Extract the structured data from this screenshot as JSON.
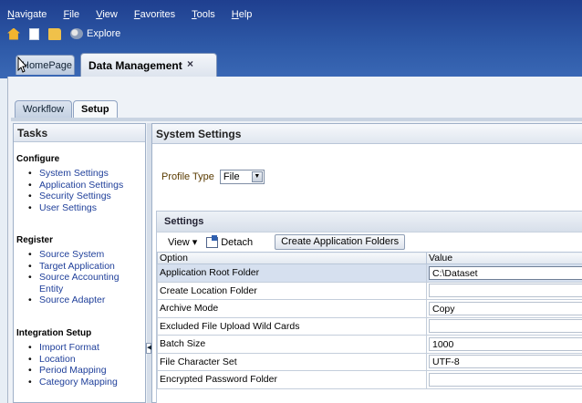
{
  "menu": [
    "Navigate",
    "File",
    "View",
    "Favorites",
    "Tools",
    "Help"
  ],
  "toolbar": {
    "explore_label": "Explore"
  },
  "outer_tabs": {
    "home": "HomePage",
    "active": "Data Management",
    "close": "×"
  },
  "inner_tabs": {
    "workflow": "Workflow",
    "setup": "Setup"
  },
  "tasks": {
    "title": "Tasks",
    "sections": [
      {
        "heading": "Configure",
        "items": [
          "System Settings",
          "Application Settings",
          "Security Settings",
          "User Settings"
        ]
      },
      {
        "heading": "Register",
        "items": [
          "Source System",
          "Target Application",
          "Source Accounting Entity",
          "Source Adapter"
        ]
      },
      {
        "heading": "Integration Setup",
        "items": [
          "Import Format",
          "Location",
          "Period Mapping",
          "Category Mapping"
        ]
      }
    ]
  },
  "main": {
    "title": "System Settings",
    "profile_label": "Profile Type",
    "profile_value": "File",
    "settings": {
      "title": "Settings",
      "view_label": "View ▾",
      "detach_label": "Detach",
      "create_label": "Create Application Folders",
      "columns": [
        "Option",
        "Value"
      ],
      "rows": [
        {
          "option": "Application Root Folder",
          "value": "C:\\Dataset"
        },
        {
          "option": "Create Location Folder",
          "value": ""
        },
        {
          "option": "Archive Mode",
          "value": "Copy"
        },
        {
          "option": "Excluded File Upload Wild Cards",
          "value": ""
        },
        {
          "option": "Batch Size",
          "value": "1000"
        },
        {
          "option": "File Character Set",
          "value": "UTF-8"
        },
        {
          "option": "Encrypted Password Folder",
          "value": ""
        }
      ]
    }
  },
  "colors": {
    "top_bar": "#2e5aa8",
    "link": "#1f3f9a",
    "selected_row": "#d6e0ef"
  }
}
